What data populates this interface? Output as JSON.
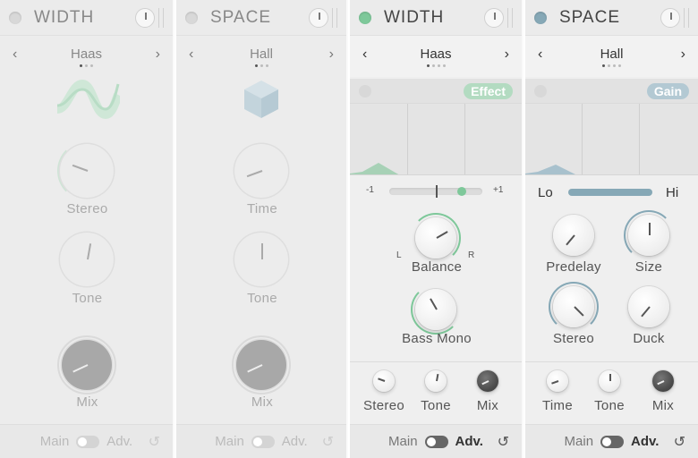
{
  "panels": [
    {
      "id": "width-faded",
      "title": "WIDTH",
      "preset": "Haas",
      "knobs": [
        "Stereo",
        "Tone",
        "Mix"
      ],
      "footer": {
        "main": "Main",
        "adv": "Adv."
      }
    },
    {
      "id": "space-faded",
      "title": "SPACE",
      "preset": "Hall",
      "knobs": [
        "Time",
        "Tone",
        "Mix"
      ],
      "footer": {
        "main": "Main",
        "adv": "Adv."
      }
    },
    {
      "id": "width-active",
      "title": "WIDTH",
      "preset": "Haas",
      "badge": "Effect",
      "slider": {
        "left": "-1",
        "right": "+1"
      },
      "balance": {
        "label": "Balance",
        "left": "L",
        "right": "R"
      },
      "bass_mono": "Bass Mono",
      "bottom_knobs": [
        "Stereo",
        "Tone",
        "Mix"
      ],
      "footer": {
        "main": "Main",
        "adv": "Adv."
      }
    },
    {
      "id": "space-active",
      "title": "SPACE",
      "preset": "Hall",
      "badge": "Gain",
      "slider": {
        "left": "Lo",
        "right": "Hi"
      },
      "grid_knobs": [
        "Predelay",
        "Size",
        "Stereo",
        "Duck"
      ],
      "bottom_knobs": [
        "Time",
        "Tone",
        "Mix"
      ],
      "footer": {
        "main": "Main",
        "adv": "Adv."
      }
    }
  ],
  "icons": {
    "nav_left": "‹",
    "nav_right": "›",
    "reset": "↺"
  },
  "colors": {
    "green_accent": "#7ec89a",
    "blue_accent": "#86a8b6"
  }
}
